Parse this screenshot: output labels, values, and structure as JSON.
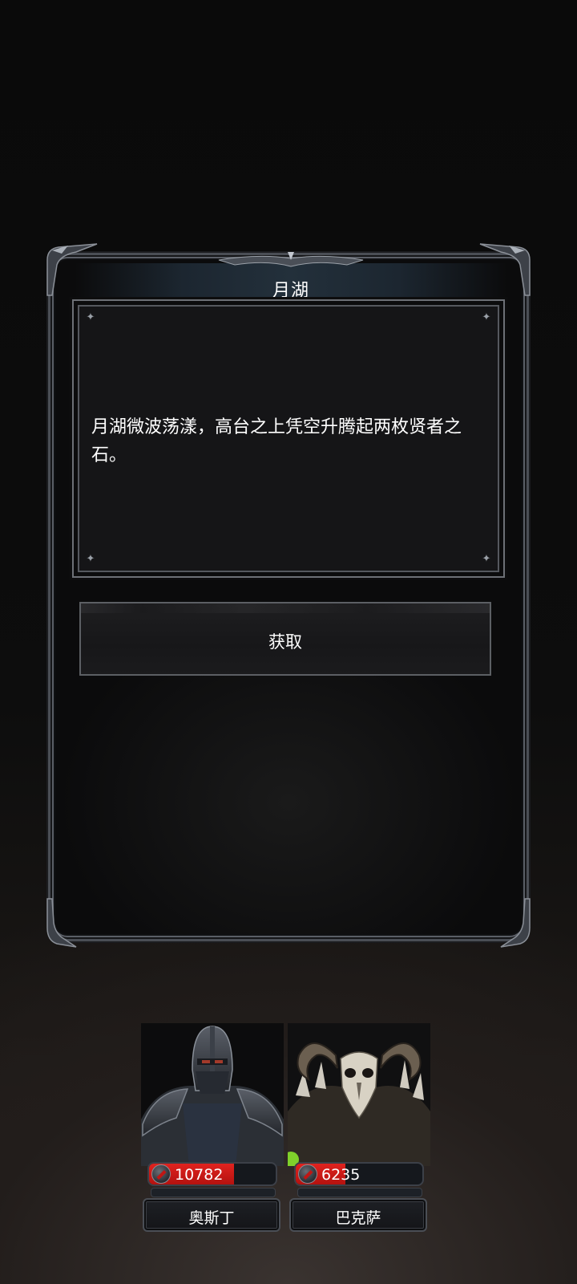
{
  "dialog": {
    "title": "月湖",
    "message": "月湖微波荡漾，高台之上凭空升腾起两枚贤者之石。",
    "action_label": "获取"
  },
  "party": [
    {
      "name": "奥斯丁",
      "hp": "10782",
      "hp_fraction": 0.67,
      "portrait": "armored-knight-portrait"
    },
    {
      "name": "巴克萨",
      "hp": "6235",
      "hp_fraction": 0.39,
      "portrait": "ram-skull-shaman-portrait"
    }
  ],
  "colors": {
    "hp_red": "#c8171a",
    "frame_steel": "#5a5e66",
    "title_band": "#23303b"
  }
}
